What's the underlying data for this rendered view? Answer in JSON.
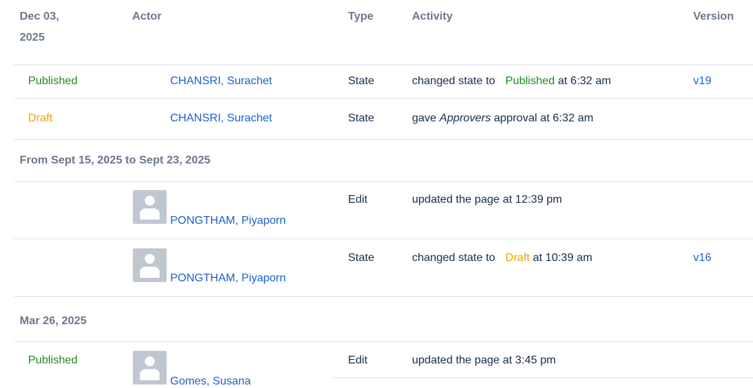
{
  "header": {
    "date_label": "Dec 03,",
    "date_year": "2025",
    "actor": "Actor",
    "type": "Type",
    "activity": "Activity",
    "version": "Version"
  },
  "rows_dec": [
    {
      "state_label": "Published",
      "actor": "CHANSRI, Surachet",
      "type": "State",
      "activity_pre": "changed state to",
      "activity_state": "Published",
      "activity_post": "at 6:32 am",
      "version": "v19"
    },
    {
      "state_label": "Draft",
      "actor": "CHANSRI, Surachet",
      "type": "State",
      "activity_pre": "gave",
      "activity_em": "Approvers",
      "activity_post": "approval at 6:32 am"
    }
  ],
  "section_sep": "From Sept 15, 2025 to Sept 23, 2025",
  "rows_sep": [
    {
      "actor": "PONGTHAM, Piyaporn",
      "type": "Edit",
      "activity": "updated the page at 12:39 pm"
    },
    {
      "actor": "PONGTHAM, Piyaporn",
      "type": "State",
      "activity_pre": "changed state to",
      "activity_state": "Draft",
      "activity_post": "at 10:39 am",
      "version": "v16"
    }
  ],
  "section_mar": "Mar 26, 2025",
  "rows_mar": [
    {
      "state_label": "Published",
      "actor": "Gomes, Susana",
      "type": "Edit",
      "activity": "updated the page at 3:45 pm"
    }
  ]
}
